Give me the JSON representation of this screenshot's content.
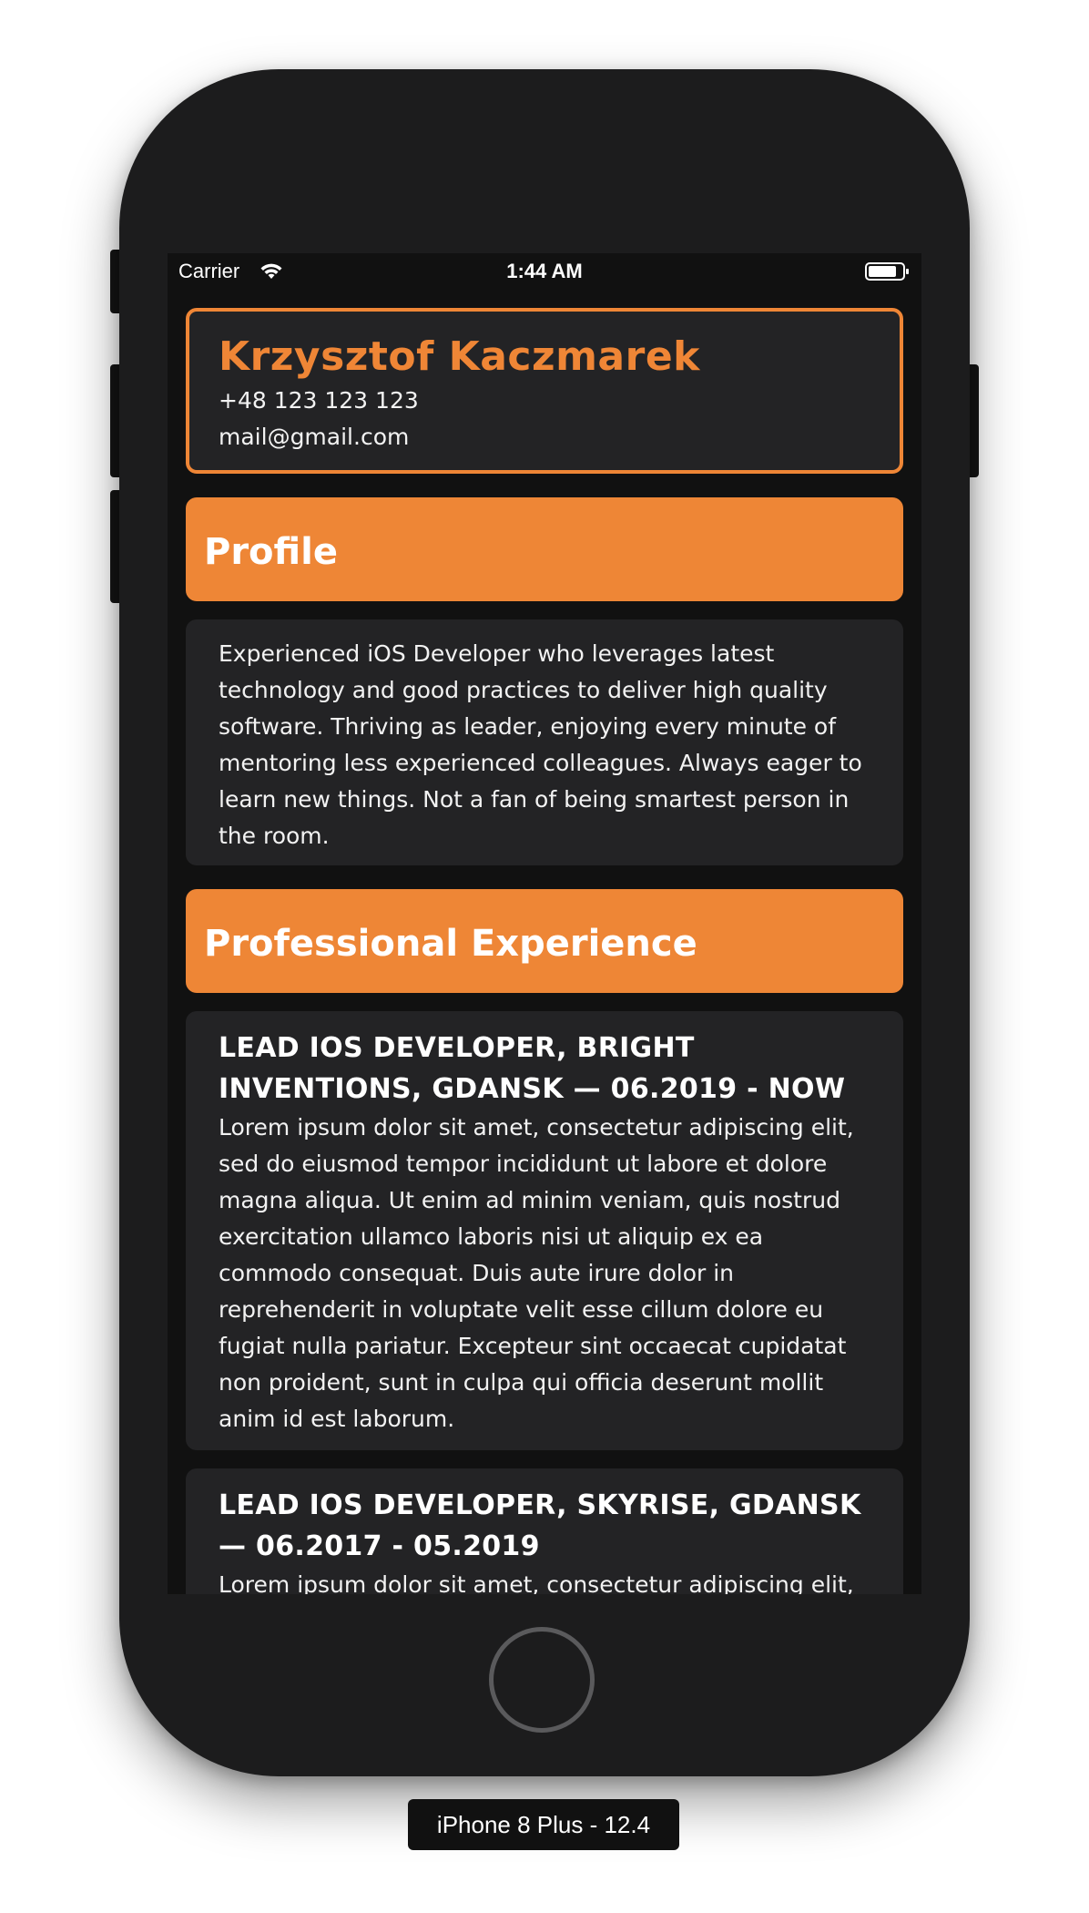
{
  "status_bar": {
    "carrier": "Carrier",
    "time": "1:44 AM",
    "wifi_icon": "wifi-icon",
    "battery_icon": "battery-icon"
  },
  "header": {
    "name": "Krzysztof Kaczmarek",
    "phone": "+48 123 123 123",
    "email": "mail@gmail.com"
  },
  "profile": {
    "title": "Profile",
    "text": "Experienced iOS Developer who leverages latest technology and good practices to deliver high quality software. Thriving as leader, enjoying every minute of mentoring less experienced colleagues. Always eager to learn new things. Not a fan of being smartest person in the room."
  },
  "experience": {
    "title": "Professional Experience",
    "jobs": [
      {
        "title": "LEAD IOS DEVELOPER, BRIGHT INVENTIONS, GDANSK — 06.2019 - NOW",
        "description": "Lorem ipsum dolor sit amet, consectetur adipiscing elit, sed do eiusmod tempor incididunt ut labore et dolore magna aliqua. Ut enim ad minim veniam, quis nostrud exercitation ullamco laboris nisi ut aliquip ex ea commodo consequat. Duis aute irure dolor in reprehenderit in voluptate velit esse cillum dolore eu fugiat nulla pariatur. Excepteur sint occaecat cupidatat non proident, sunt in culpa qui officia deserunt mollit anim id est laborum."
      },
      {
        "title": "LEAD IOS DEVELOPER, SKYRISE, GDANSK — 06.2017 - 05.2019",
        "description": "Lorem ipsum dolor sit amet, consectetur adipiscing elit,"
      }
    ]
  },
  "simulator": {
    "device_label": "iPhone 8 Plus - 12.4"
  },
  "colors": {
    "accent": "#ee8636",
    "card_background": "#232325",
    "screen_background": "#111111"
  }
}
